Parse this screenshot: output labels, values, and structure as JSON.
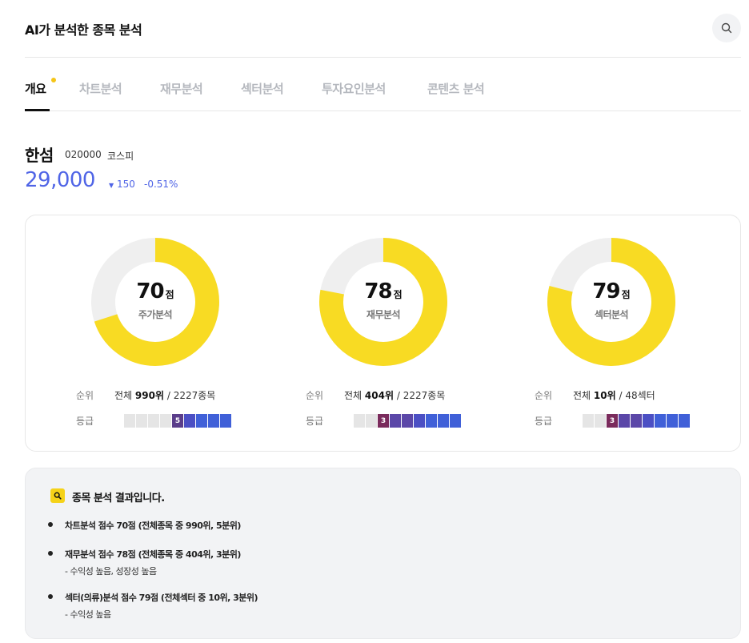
{
  "header": {
    "title": "AI가 분석한 종목 분석"
  },
  "tabs": [
    {
      "label": "개요"
    },
    {
      "label": "차트분석"
    },
    {
      "label": "재무분석"
    },
    {
      "label": "섹터분석"
    },
    {
      "label": "투자요인분석"
    },
    {
      "label": "콘텐츠 분석"
    }
  ],
  "stock": {
    "name": "한섬",
    "code": "020000",
    "market": "코스피",
    "price": "29,000",
    "change_arrow": "▼",
    "change": "150",
    "change_pct": "-0.51%"
  },
  "colors": {
    "accent_yellow": "#f8db23",
    "price_blue": "#4f64e6",
    "grade_purple_5": "#5a3d8a",
    "grade_wine_3": "#7a2b5c",
    "grade_purple": "#5b47a8",
    "grade_blue": "#4060d8",
    "grade_empty": "#e5e5e5"
  },
  "scores": [
    {
      "score": "70",
      "unit": "점",
      "label": "주가분석",
      "fraction": 0.7,
      "rank_label": "순위",
      "rank_prefix": "전체",
      "rank_value": "990위",
      "rank_total": " / 2227종목",
      "grade_label": "등급",
      "grade": "5"
    },
    {
      "score": "78",
      "unit": "점",
      "label": "재무분석",
      "fraction": 0.78,
      "rank_label": "순위",
      "rank_prefix": "전체",
      "rank_value": "404위",
      "rank_total": " / 2227종목",
      "grade_label": "등급",
      "grade": "3"
    },
    {
      "score": "79",
      "unit": "점",
      "label": "섹터분석",
      "fraction": 0.79,
      "rank_label": "순위",
      "rank_prefix": "전체",
      "rank_value": "10위",
      "rank_total": " / 48섹터",
      "grade_label": "등급",
      "grade": "3"
    }
  ],
  "summary": {
    "title": "종목 분석 결과입니다.",
    "items": [
      {
        "text": "차트분석 점수 70점 (전체종목 중 990위, 5분위)",
        "sub": ""
      },
      {
        "text": "재무분석 점수 78점 (전체종목 중 404위, 3분위)",
        "sub": "- 수익성 높음, 성장성 높음"
      },
      {
        "text": "섹터(의류)분석 점수 79점 (전체섹터 중 10위, 3분위)",
        "sub": "- 수익성 높음"
      }
    ]
  }
}
